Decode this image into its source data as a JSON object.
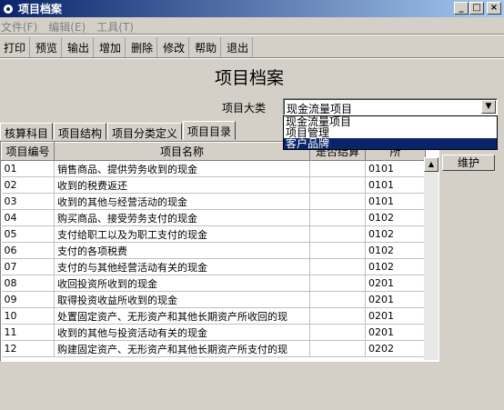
{
  "window": {
    "title": "项目档案",
    "minimize": "_",
    "maximize": "□",
    "close": "×"
  },
  "menu": [
    "文件(F)",
    "编辑(E)",
    "工具(T)"
  ],
  "toolbar": [
    "打印",
    "预览",
    "输出",
    "增加",
    "删除",
    "修改",
    "帮助",
    "退出"
  ],
  "page_title": "项目档案",
  "category": {
    "label": "项目大类",
    "value": "现金流量项目",
    "options": [
      "现金流量项目",
      "项目管理",
      "客户品牌"
    ],
    "highlighted_index": 2
  },
  "tabs": [
    "核算科目",
    "项目结构",
    "项目分类定义",
    "项目目录"
  ],
  "active_tab": 3,
  "maintain_button": "维护",
  "table": {
    "headers": [
      "项目编号",
      "项目名称",
      "是否结算",
      "所"
    ],
    "rows": [
      [
        "01",
        "销售商品、提供劳务收到的现金",
        "",
        "0101"
      ],
      [
        "02",
        "收到的税费返还",
        "",
        "0101"
      ],
      [
        "03",
        "收到的其他与经营活动的现金",
        "",
        "0101"
      ],
      [
        "04",
        "购买商品、接受劳务支付的现金",
        "",
        "0102"
      ],
      [
        "05",
        "支付给职工以及为职工支付的现金",
        "",
        "0102"
      ],
      [
        "06",
        "支付的各项税费",
        "",
        "0102"
      ],
      [
        "07",
        "支付的与其他经营活动有关的现金",
        "",
        "0102"
      ],
      [
        "08",
        "收回投资所收到的现金",
        "",
        "0201"
      ],
      [
        "09",
        "取得投资收益所收到的现金",
        "",
        "0201"
      ],
      [
        "10",
        "处置固定资产、无形资产和其他长期资产所收回的现",
        "",
        "0201"
      ],
      [
        "11",
        "收到的其他与投资活动有关的现金",
        "",
        "0201"
      ],
      [
        "12",
        "购建固定资产、无形资产和其他长期资产所支付的现",
        "",
        "0202"
      ]
    ]
  },
  "colors": {
    "titlebar_start": "#0a246a",
    "titlebar_end": "#a6caf0",
    "selection": "#0a246a",
    "face": "#d4d0c8"
  }
}
